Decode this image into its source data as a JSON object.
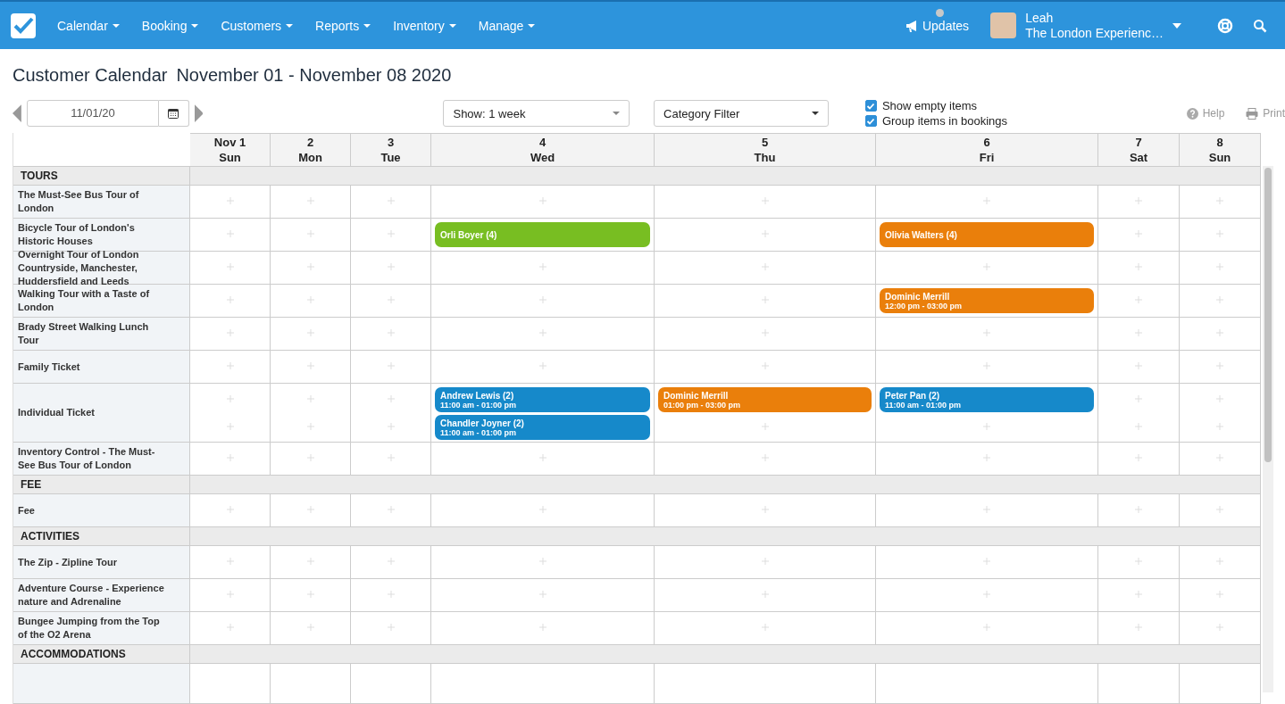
{
  "nav": {
    "menus": [
      {
        "label": "Calendar"
      },
      {
        "label": "Booking"
      },
      {
        "label": "Customers"
      },
      {
        "label": "Reports"
      },
      {
        "label": "Inventory"
      },
      {
        "label": "Manage"
      }
    ],
    "updates": "Updates",
    "user": {
      "name": "Leah",
      "company": "The London Experienc…"
    }
  },
  "page": {
    "title": "Customer Calendar",
    "range": "November 01 - November 08 2020"
  },
  "toolbar": {
    "date": "11/01/20",
    "show": "Show: 1 week",
    "category": "Category Filter",
    "options": [
      {
        "label": "Show empty items",
        "checked": true
      },
      {
        "label": "Group items in bookings",
        "checked": true
      }
    ],
    "help": "Help",
    "print": "Print"
  },
  "days": [
    {
      "date": "Nov 1",
      "weekday": "Sun"
    },
    {
      "date": "2",
      "weekday": "Mon"
    },
    {
      "date": "3",
      "weekday": "Tue"
    },
    {
      "date": "4",
      "weekday": "Wed"
    },
    {
      "date": "5",
      "weekday": "Thu"
    },
    {
      "date": "6",
      "weekday": "Fri"
    },
    {
      "date": "7",
      "weekday": "Sat"
    },
    {
      "date": "8",
      "weekday": "Sun"
    }
  ],
  "categories": [
    {
      "name": "TOURS",
      "items": [
        {
          "name": "The Must-See Bus Tour of London",
          "cells": [
            [],
            [],
            [],
            [],
            [],
            [],
            [],
            []
          ]
        },
        {
          "name": "Bicycle Tour of London's Historic Houses",
          "cells": [
            [],
            [],
            [],
            [
              {
                "name": "Orli Boyer (4)",
                "color": "#78be22"
              }
            ],
            [],
            [
              {
                "name": "Olivia Walters (4)",
                "color": "#ea7f0b"
              }
            ],
            [],
            []
          ]
        },
        {
          "name": "Overnight Tour of London Countryside, Manchester, Huddersfield and Leeds",
          "cells": [
            [],
            [],
            [],
            [],
            [],
            [],
            [],
            []
          ]
        },
        {
          "name": "Walking Tour with a Taste of London",
          "cells": [
            [],
            [],
            [],
            [],
            [],
            [
              {
                "name": "Dominic Merrill",
                "time": "12:00 pm - 03:00 pm",
                "color": "#ea7f0b"
              }
            ],
            [],
            []
          ]
        },
        {
          "name": "Brady Street Walking Lunch Tour",
          "cells": [
            [],
            [],
            [],
            [],
            [],
            [],
            [],
            []
          ]
        },
        {
          "name": "Family Ticket",
          "cells": [
            [],
            [],
            [],
            [],
            [],
            [],
            [],
            []
          ]
        },
        {
          "name": "Individual Ticket",
          "cells": [
            [],
            [],
            [],
            [
              {
                "name": "Andrew Lewis (2)",
                "time": "11:00 am - 01:00 pm",
                "color": "#1689ca"
              },
              {
                "name": "Chandler Joyner (2)",
                "time": "11:00 am - 01:00 pm",
                "color": "#1689ca"
              }
            ],
            [
              {
                "name": "Dominic Merrill",
                "time": "01:00 pm - 03:00 pm",
                "color": "#ea7f0b"
              }
            ],
            [
              {
                "name": "Peter Pan (2)",
                "time": "11:00 am - 01:00 pm",
                "color": "#1689ca"
              }
            ],
            [],
            []
          ]
        },
        {
          "name": "Inventory Control - The Must-See Bus Tour of London",
          "cells": [
            [],
            [],
            [],
            [],
            [],
            [],
            [],
            []
          ]
        }
      ]
    },
    {
      "name": "FEE",
      "items": [
        {
          "name": "Fee",
          "cells": [
            [],
            [],
            [],
            [],
            [],
            [],
            [],
            []
          ]
        }
      ]
    },
    {
      "name": "ACTIVITIES",
      "items": [
        {
          "name": "The Zip - Zipline Tour",
          "cells": [
            [],
            [],
            [],
            [],
            [],
            [],
            [],
            []
          ]
        },
        {
          "name": "Adventure Course - Experience nature and Adrenaline",
          "cells": [
            [],
            [],
            [],
            [],
            [],
            [],
            [],
            []
          ]
        },
        {
          "name": "Bungee Jumping from the Top of the O2 Arena",
          "cells": [
            [],
            [],
            [],
            [],
            [],
            [],
            [],
            []
          ]
        }
      ]
    },
    {
      "name": "ACCOMMODATIONS"
    }
  ]
}
